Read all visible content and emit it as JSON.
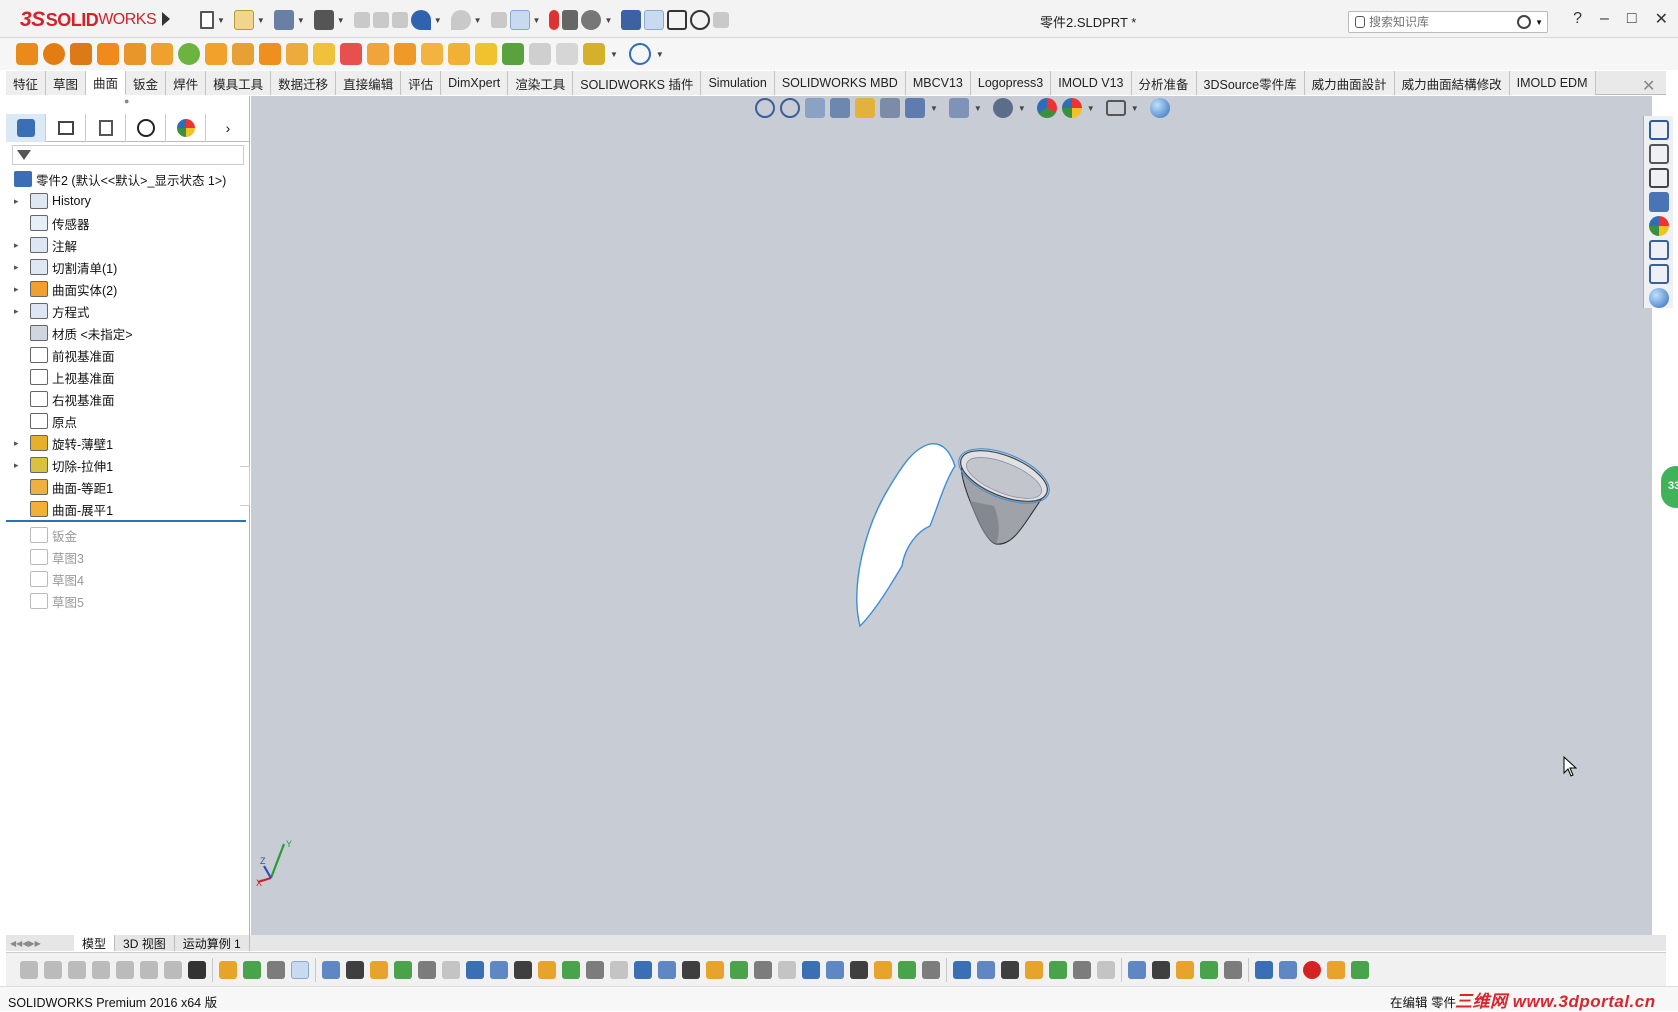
{
  "app": {
    "title": "零件2.SLDPRT *",
    "logo_ds": "3S",
    "logo_solid": "SOLID",
    "logo_works": "WORKS"
  },
  "search": {
    "placeholder": "搜索知识库"
  },
  "window_buttons": {
    "help": "?",
    "minimize": "–",
    "maximize": "□",
    "close": "✕"
  },
  "tabs": [
    "特征",
    "草图",
    "曲面",
    "钣金",
    "焊件",
    "模具工具",
    "数据迁移",
    "直接编辑",
    "评估",
    "DimXpert",
    "渲染工具",
    "SOLIDWORKS 插件",
    "Simulation",
    "SOLIDWORKS MBD",
    "MBCV13",
    "Logopress3",
    "IMOLD V13",
    "分析准备",
    "3DSource零件库",
    "威力曲面設計",
    "威力曲面結構修改",
    "IMOLD EDM"
  ],
  "active_tab": "曲面",
  "tree": {
    "root": "零件2  (默认<<默认>_显示状态 1>)",
    "items": [
      {
        "label": "History",
        "expandable": true
      },
      {
        "label": "传感器",
        "expandable": false
      },
      {
        "label": "注解",
        "expandable": true
      },
      {
        "label": "切割清单(1)",
        "expandable": true
      },
      {
        "label": "曲面实体(2)",
        "expandable": true
      },
      {
        "label": "方程式",
        "expandable": true
      },
      {
        "label": "材质 <未指定>",
        "expandable": false
      },
      {
        "label": "前视基准面",
        "expandable": false
      },
      {
        "label": "上视基准面",
        "expandable": false
      },
      {
        "label": "右视基准面",
        "expandable": false
      },
      {
        "label": "原点",
        "expandable": false
      },
      {
        "label": "旋转-薄壁1",
        "expandable": true
      },
      {
        "label": "切除-拉伸1",
        "expandable": true
      },
      {
        "label": "曲面-等距1",
        "expandable": false
      },
      {
        "label": "曲面-展平1",
        "expandable": false
      }
    ],
    "suppressed": [
      "钣金",
      "草图3",
      "草图4",
      "草图5"
    ]
  },
  "bottom_tabs": [
    "模型",
    "3D 视图",
    "运动算例 1"
  ],
  "status": {
    "left": "SOLIDWORKS Premium 2016 x64 版",
    "right": "在编辑 零件"
  },
  "watermark": "三维网 www.3dportal.cn",
  "green_badge": "33",
  "triad": {
    "x": "X",
    "y": "Y",
    "z": "Z"
  },
  "colors": {
    "viewport": "#c8ccd4",
    "accent": "#2d6fb8",
    "logo_red": "#d2232a"
  }
}
